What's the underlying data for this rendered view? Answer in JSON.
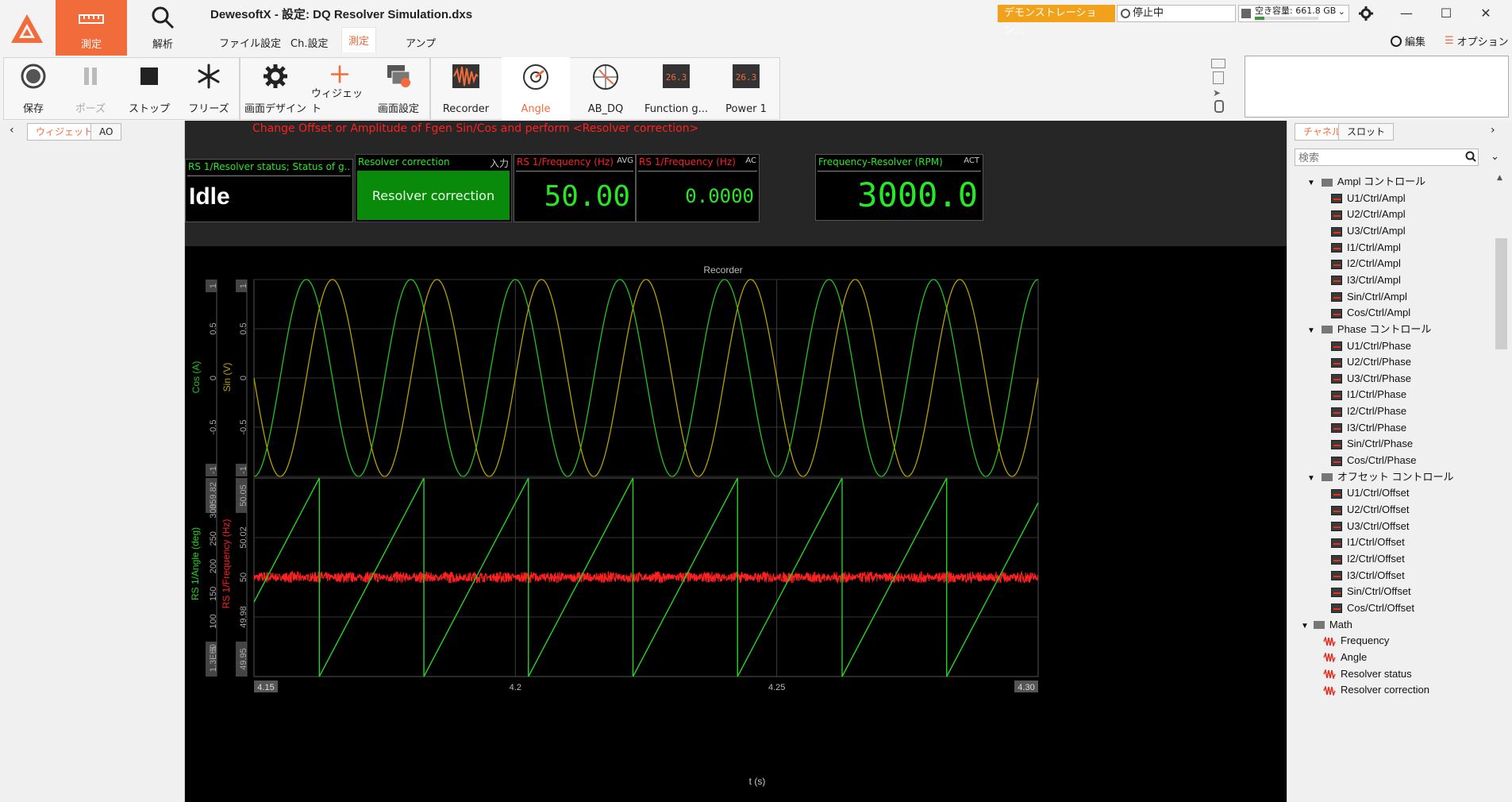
{
  "app": {
    "title": "DewesoftX - 設定: DQ Resolver Simulation.dxs",
    "modes": [
      {
        "label": "測定"
      },
      {
        "label": "解析"
      }
    ],
    "menu_tabs": [
      "ファイル設定",
      "Ch.設定",
      "測定",
      "アンプ"
    ],
    "demo_badge": "デモンストレーション...",
    "status": "停止中",
    "disk": "空き容量: 661.8 GB",
    "disk_fill_fraction": 0.15,
    "edit_label": "編集",
    "options_label": "オプション",
    "brand_color": "#f26b3a"
  },
  "toolbar": {
    "buttons": [
      {
        "label": "保存"
      },
      {
        "label": "ポーズ"
      },
      {
        "label": "ストップ"
      },
      {
        "label": "フリーズ"
      },
      {
        "label": "画面デザイン"
      },
      {
        "label": "ウィジェット"
      },
      {
        "label": "画面設定"
      },
      {
        "label": "Recorder"
      },
      {
        "label": "Angle"
      },
      {
        "label": "AB_DQ"
      },
      {
        "label": "Function g..."
      },
      {
        "label": "Power 1"
      }
    ],
    "digit_icon_text": "26.3"
  },
  "left_panel": {
    "tabs": [
      "ウィジェット",
      "AO"
    ]
  },
  "main": {
    "hint": "Change  Offset or Amplitude of Fgen Sin/Cos and perform <Resolver correction>",
    "panels": {
      "status": {
        "title": "RS 1/Resolver status; Status of g...",
        "value": "Idle"
      },
      "button": {
        "title": "Resolver correction",
        "tag": "入力",
        "label": "Resolver correction"
      },
      "freq_avg": {
        "title": "RS 1/Frequency (Hz)",
        "tag": "AVG",
        "value": "50.00"
      },
      "freq_ac": {
        "title": "RS 1/Frequency (Hz)",
        "tag": "AC",
        "value": "0.0000"
      },
      "rpm": {
        "title": "Frequency-Resolver (RPM)",
        "tag": "ACT",
        "value": "3000.0"
      }
    }
  },
  "chart_data": {
    "type": "line",
    "title": "Recorder",
    "xlabel": "t (s)",
    "xlim": [
      4.15,
      4.3
    ],
    "x_ticks": [
      "4.15",
      "4.2",
      "4.25",
      "4.30"
    ],
    "grid": true,
    "panes": [
      {
        "axes": [
          {
            "label": "Cos (A)",
            "color": "#22c322",
            "ticks": [
              "1",
              "0.5",
              "0",
              "-0.5",
              "-1"
            ]
          },
          {
            "label": "Sin (V)",
            "color": "#b8a000",
            "ticks": [
              "1",
              "0.5",
              "0",
              "-0.5",
              "-1"
            ]
          }
        ],
        "ylim": [
          -1,
          1
        ],
        "series": [
          {
            "name": "Cos (A)",
            "color": "#22c322",
            "function": "cos",
            "frequency_hz": 50,
            "amplitude": 1
          },
          {
            "name": "Sin (V)",
            "color": "#b8a000",
            "function": "sin",
            "frequency_hz": 50,
            "amplitude": 1
          }
        ]
      },
      {
        "axes": [
          {
            "label": "RS 1/Angle (deg)",
            "color": "#22d422",
            "ticks": [
              "359.82",
              "300",
              "250",
              "200",
              "150",
              "100",
              "50",
              "1.3E-5"
            ],
            "ylim": [
              0,
              359.82
            ]
          },
          {
            "label": "RS 1/Frequency (Hz)",
            "color": "#ff2020",
            "ticks": [
              "50.05",
              "50.02",
              "50",
              "49.98",
              "49.95"
            ],
            "ylim": [
              49.95,
              50.05
            ]
          }
        ],
        "series": [
          {
            "name": "RS 1/Angle (deg)",
            "color": "#22d422",
            "function": "sawtooth",
            "frequency_hz": 50,
            "ylim": [
              0,
              359.82
            ],
            "first_reset_s": 4.1625
          },
          {
            "name": "RS 1/Frequency (Hz)",
            "color": "#ff2020",
            "function": "noise",
            "center": 50,
            "noise_amplitude": 0.003
          }
        ]
      }
    ]
  },
  "right_panel": {
    "tabs": [
      "チャネル",
      "スロット"
    ],
    "search_placeholder": "検索",
    "tree": [
      {
        "label": "Ampl コントロール",
        "type": "folder"
      },
      {
        "label": "U1/Ctrl/Ampl",
        "type": "item"
      },
      {
        "label": "U2/Ctrl/Ampl",
        "type": "item"
      },
      {
        "label": "U3/Ctrl/Ampl",
        "type": "item"
      },
      {
        "label": "I1/Ctrl/Ampl",
        "type": "item"
      },
      {
        "label": "I2/Ctrl/Ampl",
        "type": "item"
      },
      {
        "label": "I3/Ctrl/Ampl",
        "type": "item"
      },
      {
        "label": "Sin/Ctrl/Ampl",
        "type": "item"
      },
      {
        "label": "Cos/Ctrl/Ampl",
        "type": "item"
      },
      {
        "label": "Phase コントロール",
        "type": "folder"
      },
      {
        "label": "U1/Ctrl/Phase",
        "type": "item"
      },
      {
        "label": "U2/Ctrl/Phase",
        "type": "item"
      },
      {
        "label": "U3/Ctrl/Phase",
        "type": "item"
      },
      {
        "label": "I1/Ctrl/Phase",
        "type": "item"
      },
      {
        "label": "I2/Ctrl/Phase",
        "type": "item"
      },
      {
        "label": "I3/Ctrl/Phase",
        "type": "item"
      },
      {
        "label": "Sin/Ctrl/Phase",
        "type": "item"
      },
      {
        "label": "Cos/Ctrl/Phase",
        "type": "item"
      },
      {
        "label": "オフセット コントロール",
        "type": "folder"
      },
      {
        "label": "U1/Ctrl/Offset",
        "type": "item"
      },
      {
        "label": "U2/Ctrl/Offset",
        "type": "item"
      },
      {
        "label": "U3/Ctrl/Offset",
        "type": "item"
      },
      {
        "label": "I1/Ctrl/Offset",
        "type": "item"
      },
      {
        "label": "I2/Ctrl/Offset",
        "type": "item"
      },
      {
        "label": "I3/Ctrl/Offset",
        "type": "item"
      },
      {
        "label": "Sin/Ctrl/Offset",
        "type": "item"
      },
      {
        "label": "Cos/Ctrl/Offset",
        "type": "item"
      },
      {
        "label": "Math",
        "type": "folder2"
      },
      {
        "label": "Frequency",
        "type": "math"
      },
      {
        "label": "Angle",
        "type": "math"
      },
      {
        "label": "Resolver status",
        "type": "math"
      },
      {
        "label": "Resolver correction",
        "type": "math"
      }
    ]
  }
}
